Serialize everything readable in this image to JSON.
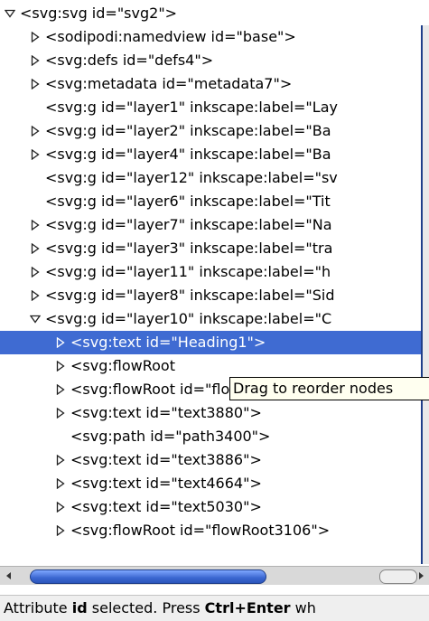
{
  "tree": {
    "rows": [
      {
        "label": "<svg:svg id=\"svg2\">",
        "indent": 0,
        "expander": "open"
      },
      {
        "label": "<sodipodi:namedview id=\"base\">",
        "indent": 1,
        "expander": "closed"
      },
      {
        "label": "<svg:defs id=\"defs4\">",
        "indent": 1,
        "expander": "closed"
      },
      {
        "label": "<svg:metadata id=\"metadata7\">",
        "indent": 1,
        "expander": "closed"
      },
      {
        "label": "<svg:g id=\"layer1\" inkscape:label=\"Lay",
        "indent": 1,
        "expander": "none"
      },
      {
        "label": "<svg:g id=\"layer2\" inkscape:label=\"Ba",
        "indent": 1,
        "expander": "closed"
      },
      {
        "label": "<svg:g id=\"layer4\" inkscape:label=\"Ba",
        "indent": 1,
        "expander": "closed"
      },
      {
        "label": "<svg:g id=\"layer12\" inkscape:label=\"sv",
        "indent": 1,
        "expander": "none"
      },
      {
        "label": "<svg:g id=\"layer6\" inkscape:label=\"Tit",
        "indent": 1,
        "expander": "none"
      },
      {
        "label": "<svg:g id=\"layer7\" inkscape:label=\"Na",
        "indent": 1,
        "expander": "closed"
      },
      {
        "label": "<svg:g id=\"layer3\" inkscape:label=\"tra",
        "indent": 1,
        "expander": "closed"
      },
      {
        "label": "<svg:g id=\"layer11\" inkscape:label=\"h",
        "indent": 1,
        "expander": "closed"
      },
      {
        "label": "<svg:g id=\"layer8\" inkscape:label=\"Sid",
        "indent": 1,
        "expander": "closed"
      },
      {
        "label": "<svg:g id=\"layer10\" inkscape:label=\"C",
        "indent": 1,
        "expander": "open"
      },
      {
        "label": "<svg:text id=\"Heading1\">",
        "indent": 2,
        "expander": "closed",
        "selected": true
      },
      {
        "label": "<svg:flowRoot",
        "indent": 2,
        "expander": "closed"
      },
      {
        "label": "<svg:flowRoot id=\"flowRoot3568\">",
        "indent": 2,
        "expander": "closed"
      },
      {
        "label": "<svg:text id=\"text3880\">",
        "indent": 2,
        "expander": "closed"
      },
      {
        "label": "<svg:path id=\"path3400\">",
        "indent": 2,
        "expander": "none"
      },
      {
        "label": "<svg:text id=\"text3886\">",
        "indent": 2,
        "expander": "closed"
      },
      {
        "label": "<svg:text id=\"text4664\">",
        "indent": 2,
        "expander": "closed"
      },
      {
        "label": "<svg:text id=\"text5030\">",
        "indent": 2,
        "expander": "closed"
      },
      {
        "label": "<svg:flowRoot id=\"flowRoot3106\">",
        "indent": 2,
        "expander": "closed"
      }
    ]
  },
  "tooltip": {
    "text": "Drag to reorder nodes"
  },
  "status": {
    "before": "Attribute ",
    "attr": "id",
    "middle": " selected. Press ",
    "key": "Ctrl+Enter",
    "after": " wh"
  },
  "colors": {
    "selection": "#3f6bd2",
    "scroll_thumb": "#3a66d0"
  },
  "icons": [
    "expander-open-icon",
    "expander-closed-icon",
    "scroll-left-arrow-icon",
    "scroll-right-arrow-icon"
  ]
}
